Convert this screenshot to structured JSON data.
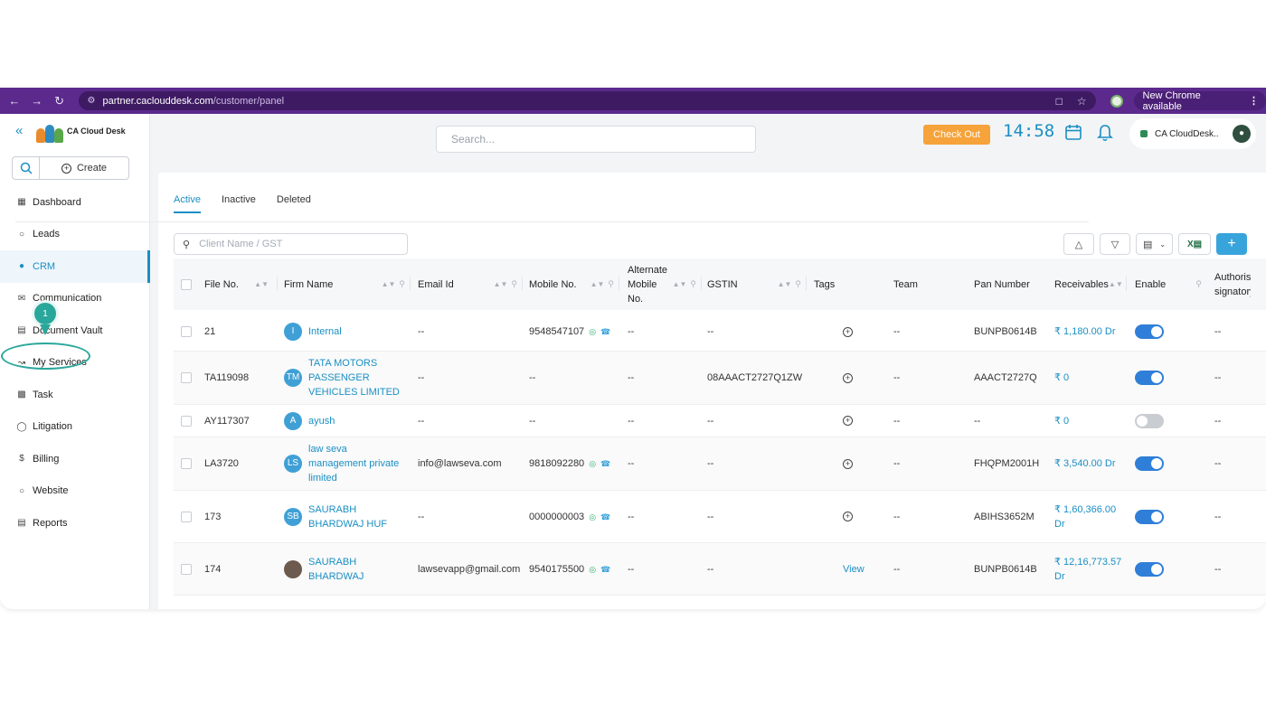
{
  "browser": {
    "url_host": "partner.caclouddesk.com",
    "url_path": "/customer/panel",
    "new_chrome_label": "New Chrome available"
  },
  "sidebar": {
    "logo_text": "CA Cloud Desk",
    "create_label": "Create",
    "items": [
      {
        "label": "Dashboard",
        "icon": "dashboard-icon"
      },
      {
        "label": "Leads",
        "icon": "user-icon"
      },
      {
        "label": "CRM",
        "icon": "users-icon"
      },
      {
        "label": "Communication",
        "icon": "mail-icon"
      },
      {
        "label": "Document Vault",
        "icon": "document-icon"
      },
      {
        "label": "My Services",
        "icon": "chart-icon"
      },
      {
        "label": "Task",
        "icon": "task-icon"
      },
      {
        "label": "Litigation",
        "icon": "shield-icon"
      },
      {
        "label": "Billing",
        "icon": "dollar-icon"
      },
      {
        "label": "Website",
        "icon": "user-icon"
      },
      {
        "label": "Reports",
        "icon": "report-icon"
      }
    ],
    "step_marker": "1"
  },
  "topbar": {
    "search_placeholder": "Search...",
    "checkout_label": "Check Out",
    "clock": "14:58",
    "account_name": "CA CloudDesk.."
  },
  "tabs": [
    "Active",
    "Inactive",
    "Deleted"
  ],
  "client_search_placeholder": "Client Name / GST",
  "table": {
    "columns": [
      "File No.",
      "Firm Name",
      "Email Id",
      "Mobile No.",
      "Alternate Mobile No.",
      "GSTIN",
      "Tags",
      "Team",
      "Pan Number",
      "Receivables",
      "Enable",
      "Authorised signatory"
    ],
    "rows": [
      {
        "file": "21",
        "initials": "I",
        "firm": "Internal",
        "email": "--",
        "mobile": "9548547107",
        "alt": "--",
        "gstin": "--",
        "tags": "add",
        "team": "--",
        "pan": "BUNPB0614B",
        "recv": "₹ 1,180.00 Dr",
        "enabled": true,
        "auth": "--"
      },
      {
        "file": "TA119098",
        "initials": "TM",
        "firm": "TATA MOTORS PASSENGER VEHICLES LIMITED",
        "email": "--",
        "mobile": "--",
        "alt": "--",
        "gstin": "08AAACT2727Q1ZW",
        "tags": "add",
        "team": "--",
        "pan": "AAACT2727Q",
        "recv": "₹ 0",
        "enabled": true,
        "auth": "--"
      },
      {
        "file": "AY117307",
        "initials": "A",
        "firm": "ayush",
        "email": "--",
        "mobile": "--",
        "alt": "--",
        "gstin": "--",
        "tags": "add",
        "team": "--",
        "pan": "--",
        "recv": "₹ 0",
        "enabled": false,
        "auth": "--"
      },
      {
        "file": "LA3720",
        "initials": "LS",
        "firm": "law seva management private limited",
        "email": "info@lawseva.com",
        "mobile": "9818092280",
        "alt": "--",
        "gstin": "--",
        "tags": "add",
        "team": "--",
        "pan": "FHQPM2001H",
        "recv": "₹ 3,540.00 Dr",
        "enabled": true,
        "auth": "--"
      },
      {
        "file": "173",
        "initials": "SB",
        "firm": "SAURABH BHARDWAJ HUF",
        "email": "--",
        "mobile": "0000000003",
        "alt": "--",
        "gstin": "--",
        "tags": "add",
        "team": "--",
        "pan": "ABIHS3652M",
        "recv": "₹ 1,60,366.00 Dr",
        "enabled": true,
        "auth": "--"
      },
      {
        "file": "174",
        "initials": "",
        "firm": "SAURABH BHARDWAJ",
        "email": "lawsevapp@gmail.com",
        "mobile": "9540175500",
        "alt": "--",
        "gstin": "--",
        "tags": "View",
        "team": "--",
        "pan": "BUNPB0614B",
        "recv": "₹ 12,16,773.57 Dr",
        "enabled": true,
        "auth": "--"
      }
    ]
  },
  "colors": {
    "accent": "#1a8fc4",
    "chrome": "#5b2a8c",
    "checkout": "#f5a33a",
    "marker": "#2aa79b"
  }
}
